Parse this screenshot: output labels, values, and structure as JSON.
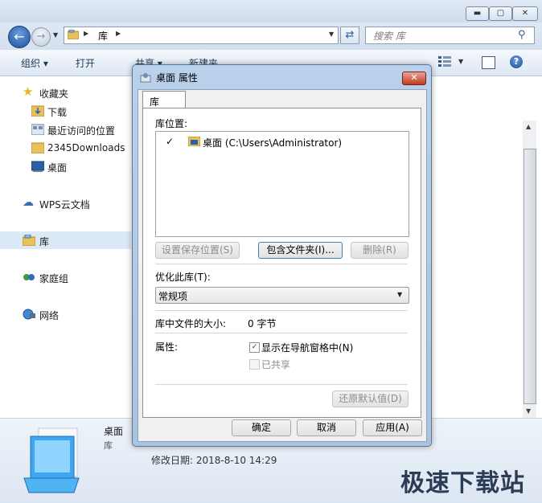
{
  "explorer": {
    "address": {
      "location": "库"
    },
    "search": {
      "placeholder": "搜索 库"
    },
    "toolbar": {
      "organize": "组织 ▾",
      "open": "打开",
      "share": "共享 ▾",
      "new_folder": "新建夹"
    },
    "nav": {
      "favorites": "收藏夹",
      "items": [
        "下载",
        "最近访问的位置",
        "2345Downloads",
        "桌面"
      ],
      "wps": "WPS云文档",
      "library": "库",
      "homegroup": "家庭组",
      "network": "网络"
    },
    "details": {
      "name": "桌面",
      "type": "库",
      "modified": "修改日期: 2018-8-10 14:29"
    },
    "watermark": "极速下载站"
  },
  "dialog": {
    "title": "桌面 属性",
    "close_glyph": "✕",
    "tab": "库",
    "locations_label": "库位置:",
    "locations": [
      {
        "checked": "✓",
        "text": "桌面 (C:\\Users\\Administrator)"
      }
    ],
    "buttons": {
      "set_save": "设置保存位置(S)",
      "include": "包含文件夹(I)...",
      "remove": "删除(R)",
      "restore": "还原默认值(D)",
      "ok": "确定",
      "cancel": "取消",
      "apply": "应用(A)"
    },
    "optimize_label": "优化此库(T):",
    "optimize_value": "常规项",
    "size_label": "库中文件的大小:",
    "size_value": "0 字节",
    "attributes_label": "属性:",
    "show_in_nav": {
      "label": "显示在导航窗格中(N)",
      "checked": true,
      "mark": "✓"
    },
    "shared": {
      "label": "已共享",
      "checked": false
    }
  }
}
